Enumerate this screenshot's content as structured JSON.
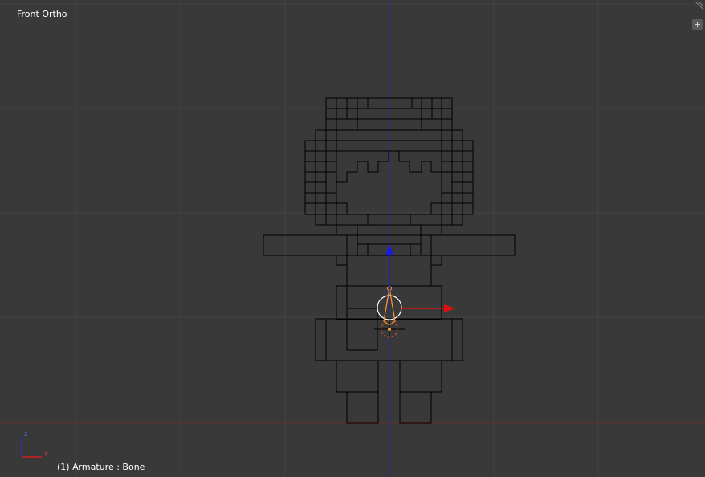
{
  "viewport": {
    "view_name": "Front Ortho",
    "status_text": "(1) Armature : Bone",
    "plus_label": "+"
  },
  "axes_gizmo": {
    "z_label": "z",
    "x_label": "x"
  },
  "colors": {
    "background": "#393939",
    "grid": "#424242",
    "wire": "#000000",
    "z_axis": "#1f1fcc",
    "x_axis": "#b02020",
    "bone_selected": "#ff9a2e",
    "text": "#ffffff"
  }
}
